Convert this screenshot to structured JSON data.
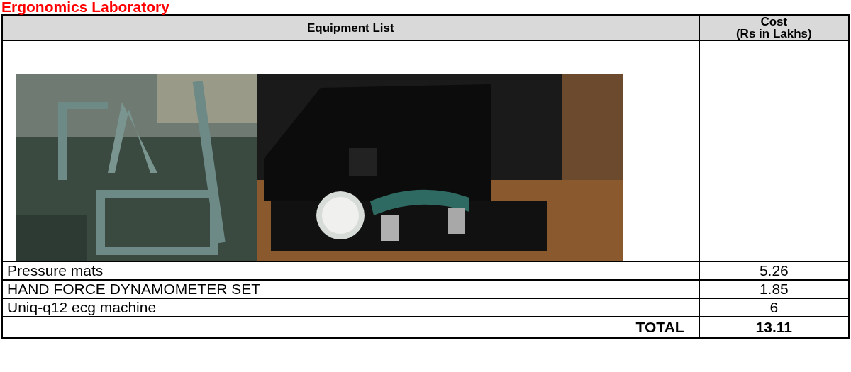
{
  "title": "Ergonomics Laboratory",
  "table": {
    "columns": [
      "Equipment List",
      "Cost\n(Rs in Lakhs)"
    ],
    "picture_row": {
      "pictures": [
        {
          "kind": "picture"
        },
        {
          "kind": "picture"
        }
      ]
    },
    "rows": [
      {
        "item": "Pressure mats",
        "cost": "5.26"
      },
      {
        "item": "HAND FORCE DYNAMOMETER SET",
        "cost": "1.85"
      },
      {
        "item": "Uniq-q12 ecg machine",
        "cost": "6"
      }
    ],
    "total": {
      "label": "TOTAL",
      "value": "13.11"
    }
  }
}
